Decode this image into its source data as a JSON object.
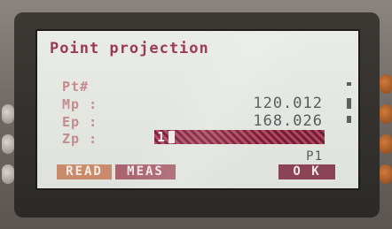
{
  "screen": {
    "title": "Point projection",
    "fields": [
      {
        "label": "Pt#",
        "value": ""
      },
      {
        "label": "Mp :",
        "value": "120.012"
      },
      {
        "label": "Ep :",
        "value": "168.026"
      },
      {
        "label": "Zp :",
        "value": "1"
      }
    ],
    "page_indicator": "P1"
  },
  "softkeys": {
    "read": "READ",
    "meas": "MEAS",
    "ok": "O K"
  },
  "colors": {
    "title": "#9a3a55",
    "label": "#c78a8f",
    "value": "#555c5e",
    "active_field": "#b8455f",
    "softkey_read": "#c98b6c",
    "softkey_meas": "#a8636e",
    "softkey_ok": "#8a4455"
  }
}
